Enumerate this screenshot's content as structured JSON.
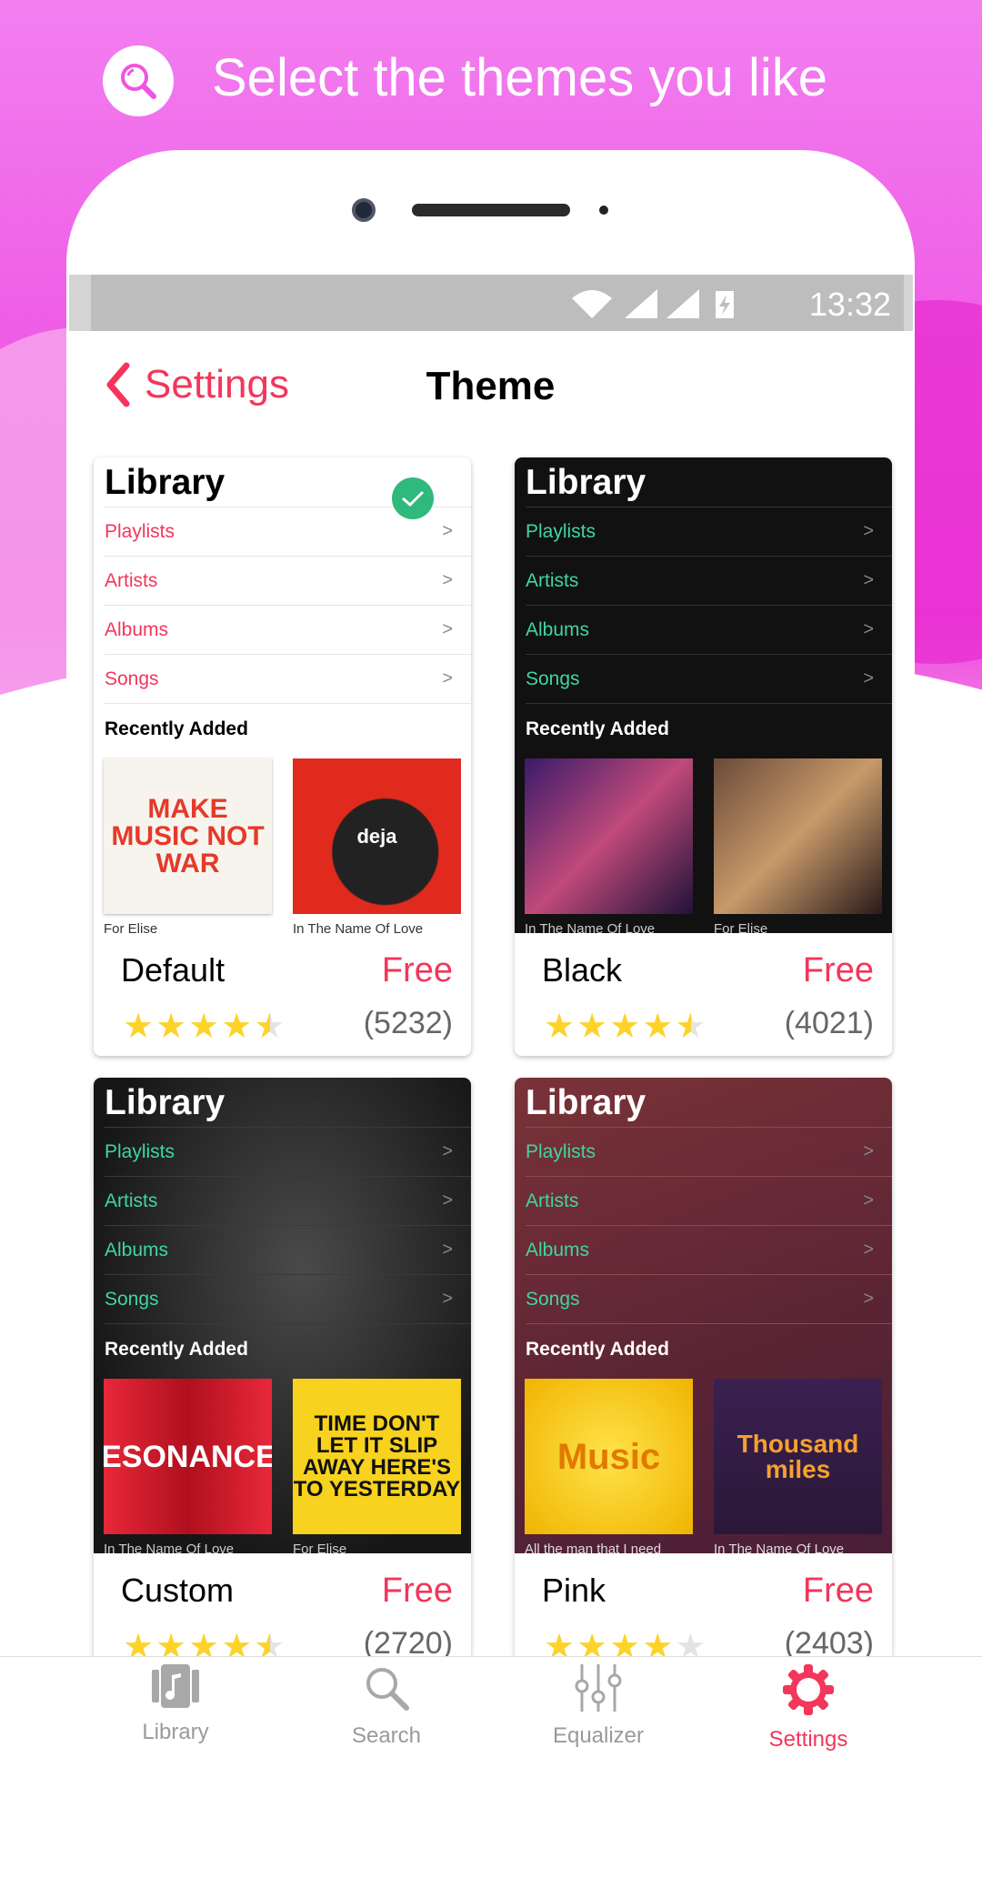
{
  "header": {
    "text": "Select the themes you like",
    "icon": "search-icon"
  },
  "status_bar": {
    "time": "13:32",
    "icons": [
      "wifi-icon",
      "signal-icon",
      "signal-icon",
      "battery-charging-icon"
    ]
  },
  "nav": {
    "back_label": "Settings",
    "title": "Theme"
  },
  "colors": {
    "accent": "#f3365a",
    "check": "#2fb97c",
    "star": "#fdd32a",
    "background": "#f07ef0"
  },
  "preview_labels": {
    "library": "Library",
    "rows": [
      "Playlists",
      "Artists",
      "Albums",
      "Songs"
    ],
    "recently_added": "Recently Added"
  },
  "themes": [
    {
      "name": "Default",
      "price": "Free",
      "rating": 4.5,
      "count": "(5232)",
      "selected": true,
      "albums": [
        {
          "caption": "For Elise",
          "art": "MAKE MUSIC NOT WAR"
        },
        {
          "caption": "In The Name Of Love",
          "art": "deja"
        }
      ]
    },
    {
      "name": "Black",
      "price": "Free",
      "rating": 4.5,
      "count": "(4021)",
      "selected": false,
      "albums": [
        {
          "caption": "In The Name Of Love",
          "art": ""
        },
        {
          "caption": "For Elise",
          "art": ""
        }
      ]
    },
    {
      "name": "Custom",
      "price": "Free",
      "rating": 4.5,
      "count": "(2720)",
      "selected": false,
      "albums": [
        {
          "caption": "In The Name Of Love",
          "art": "RESONANCES"
        },
        {
          "caption": "For Elise",
          "art": "TIME DON'T LET IT SLIP AWAY HERE'S TO YESTERDAY"
        }
      ]
    },
    {
      "name": "Pink",
      "price": "Free",
      "rating": 4,
      "count": "(2403)",
      "selected": false,
      "albums": [
        {
          "caption": "All the man that I need",
          "art": "Music"
        },
        {
          "caption": "In The Name Of Love",
          "art": "Thousand miles"
        }
      ]
    }
  ],
  "tabs": [
    {
      "label": "Library",
      "icon": "library-icon",
      "active": false
    },
    {
      "label": "Search",
      "icon": "search-icon",
      "active": false
    },
    {
      "label": "Equalizer",
      "icon": "equalizer-icon",
      "active": false
    },
    {
      "label": "Settings",
      "icon": "gear-icon",
      "active": true
    }
  ]
}
